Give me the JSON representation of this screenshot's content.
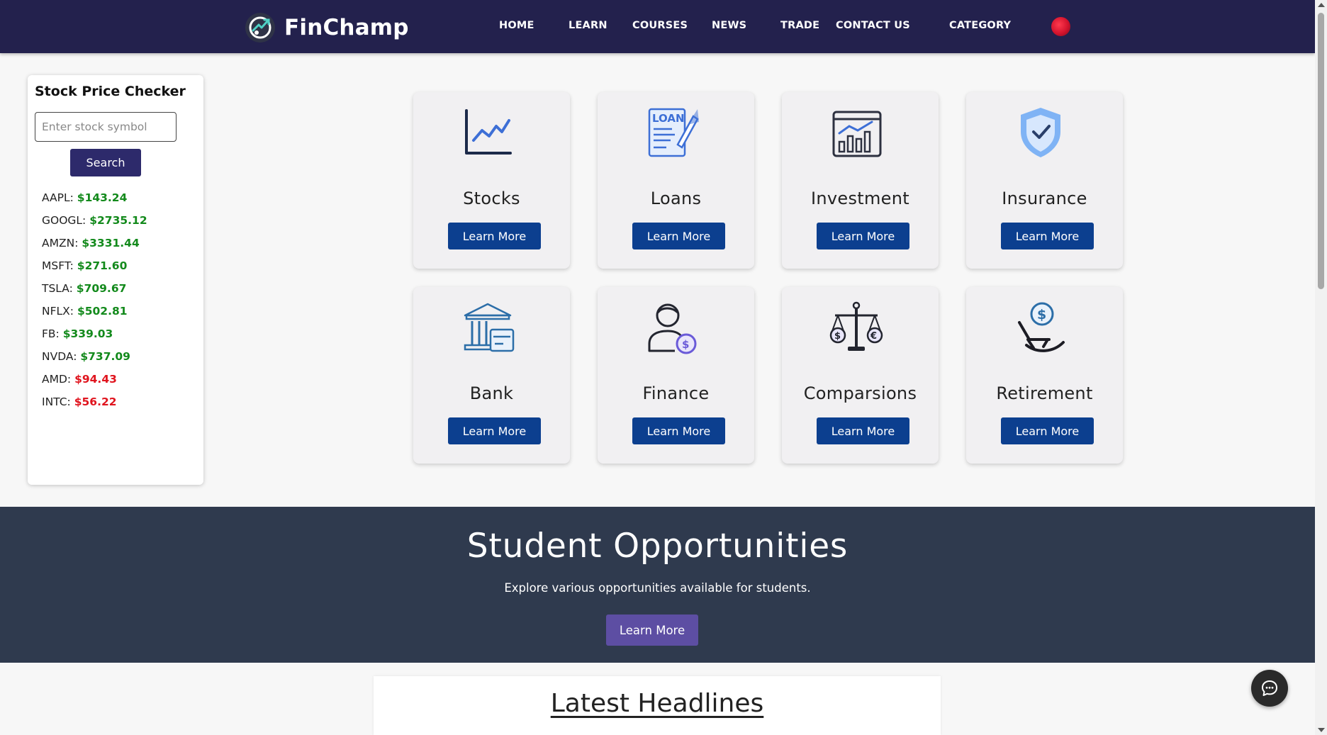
{
  "brand": {
    "name": "FinChamp",
    "logo_icon": "finchamp-logo-icon"
  },
  "nav": {
    "links": [
      {
        "label": "HOME"
      },
      {
        "label": "LEARN"
      },
      {
        "label": "COURSES"
      },
      {
        "label": "NEWS"
      },
      {
        "label": "TRADE"
      },
      {
        "label": "CONTACT US"
      },
      {
        "label": "CATEGORY"
      }
    ],
    "avatar_icon": "user-avatar-icon"
  },
  "stock_checker": {
    "title": "Stock Price Checker",
    "input_placeholder": "Enter stock symbol",
    "input_value": "",
    "search_label": "Search",
    "up_color": "#138a1c",
    "down_color": "#e0141e",
    "stocks": [
      {
        "symbol": "AAPL:",
        "price": "$143.24",
        "trend": "up"
      },
      {
        "symbol": "GOOGL:",
        "price": "$2735.12",
        "trend": "up"
      },
      {
        "symbol": "AMZN:",
        "price": "$3331.44",
        "trend": "up"
      },
      {
        "symbol": "MSFT:",
        "price": "$271.60",
        "trend": "up"
      },
      {
        "symbol": "TSLA:",
        "price": "$709.67",
        "trend": "up"
      },
      {
        "symbol": "NFLX:",
        "price": "$502.81",
        "trend": "up"
      },
      {
        "symbol": "FB:",
        "price": "$339.03",
        "trend": "up"
      },
      {
        "symbol": "NVDA:",
        "price": "$737.09",
        "trend": "up"
      },
      {
        "symbol": "AMD:",
        "price": "$94.43",
        "trend": "down"
      },
      {
        "symbol": "INTC:",
        "price": "$56.22",
        "trend": "down"
      }
    ]
  },
  "categories": [
    {
      "title": "Stocks",
      "icon": "line-chart-icon",
      "button": "Learn More"
    },
    {
      "title": "Loans",
      "icon": "loan-document-icon",
      "button": "Learn More"
    },
    {
      "title": "Investment",
      "icon": "investment-chart-icon",
      "button": "Learn More"
    },
    {
      "title": "Insurance",
      "icon": "shield-check-icon",
      "button": "Learn More"
    },
    {
      "title": "Bank",
      "icon": "bank-building-icon",
      "button": "Learn More"
    },
    {
      "title": "Finance",
      "icon": "person-dollar-icon",
      "button": "Learn More"
    },
    {
      "title": "Comparsions",
      "icon": "balance-scale-icon",
      "button": "Learn More"
    },
    {
      "title": "Retirement",
      "icon": "rocking-chair-dollar-icon",
      "button": "Learn More"
    }
  ],
  "student": {
    "title": "Student Opportunities",
    "subtitle": "Explore various opportunities available for students.",
    "button": "Learn More"
  },
  "headlines": {
    "title": "Latest Headlines"
  },
  "chat": {
    "icon": "chat-bubble-icon"
  },
  "colors": {
    "navbar": "#23214d",
    "card_button": "#0c3f8f",
    "student_bg": "#2f3a4e",
    "student_button": "#5d4ea3"
  }
}
